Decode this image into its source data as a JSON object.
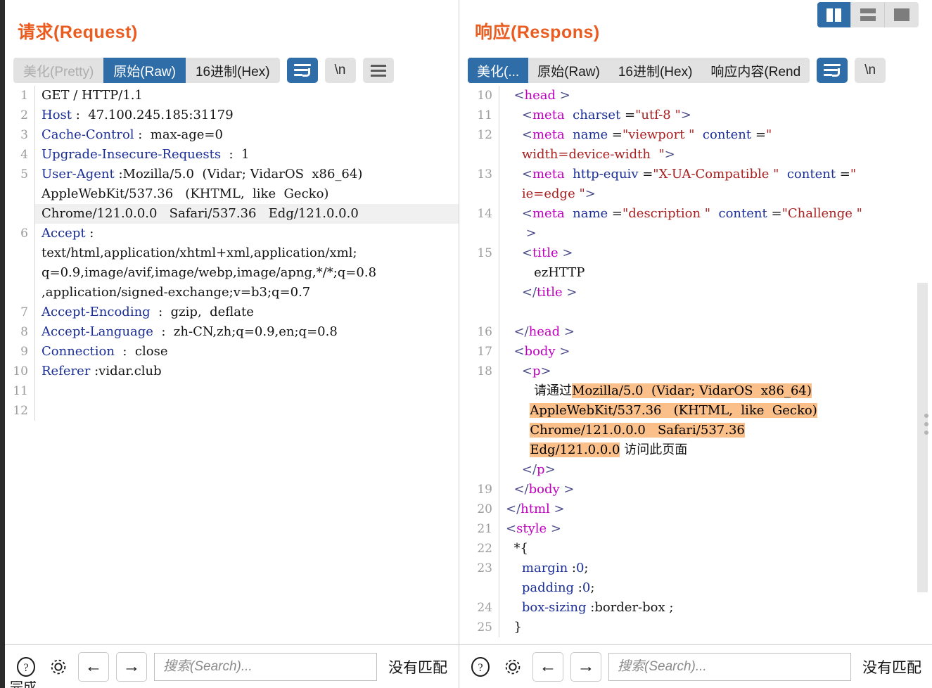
{
  "window": {
    "layout_modes": [
      {
        "name": "split-view",
        "label": "split",
        "active": true
      },
      {
        "name": "stacked-view",
        "label": "stacked",
        "active": false
      },
      {
        "name": "single-view",
        "label": "single",
        "active": false
      }
    ]
  },
  "request": {
    "title": "请求(Request)",
    "tabs": [
      {
        "label": "美化(Pretty)",
        "state": "disabled"
      },
      {
        "label": "原始(Raw)",
        "state": "active"
      },
      {
        "label": "16进制(Hex)",
        "state": "normal"
      }
    ],
    "buttons": {
      "wrap": {
        "name": "word-wrap-toggle",
        "active": true
      },
      "newline": {
        "label": "\\n",
        "name": "newline-toggle",
        "active": false
      },
      "menu": {
        "name": "more-menu",
        "active": false
      }
    },
    "lines": [
      {
        "n": "1",
        "segments": [
          {
            "t": "GET / HTTP/1.1",
            "c": "plain"
          }
        ]
      },
      {
        "n": "2",
        "segments": [
          {
            "t": "Host",
            "c": "hkey"
          },
          {
            "t": " :  47.100.245.185:31179",
            "c": "plain"
          }
        ]
      },
      {
        "n": "3",
        "segments": [
          {
            "t": "Cache-Control",
            "c": "hkey"
          },
          {
            "t": " :  max-age=0",
            "c": "plain"
          }
        ]
      },
      {
        "n": "4",
        "segments": [
          {
            "t": "Upgrade-Insecure-Requests",
            "c": "hkey"
          },
          {
            "t": "  :  1",
            "c": "plain"
          }
        ]
      },
      {
        "n": "5",
        "segments": [
          {
            "t": "User-Agent",
            "c": "hkey"
          },
          {
            "t": " :Mozilla/5.0  (Vidar; VidarOS  x86_64)",
            "c": "plain"
          }
        ]
      },
      {
        "n": "",
        "segments": [
          {
            "t": "AppleWebKit/537.36   (KHTML,  like  Gecko)",
            "c": "plain"
          }
        ]
      },
      {
        "n": "",
        "segments": [
          {
            "t": "Chrome/121.0.0.0   Safari/537.36   Edg/121.0.0.0",
            "c": "plain"
          }
        ],
        "highlight": true
      },
      {
        "n": "6",
        "segments": [
          {
            "t": "Accept",
            "c": "hkey"
          },
          {
            "t": " :",
            "c": "plain"
          }
        ]
      },
      {
        "n": "",
        "segments": [
          {
            "t": "text/html,application/xhtml+xml,application/xml;",
            "c": "plain"
          }
        ]
      },
      {
        "n": "",
        "segments": [
          {
            "t": "q=0.9,image/avif,image/webp,image/apng,*/*;q=0.8",
            "c": "plain"
          }
        ]
      },
      {
        "n": "",
        "segments": [
          {
            "t": ",application/signed-exchange;v=b3;q=0.7",
            "c": "plain"
          }
        ]
      },
      {
        "n": "7",
        "segments": [
          {
            "t": "Accept-Encoding",
            "c": "hkey"
          },
          {
            "t": "  :  gzip,  deflate",
            "c": "plain"
          }
        ]
      },
      {
        "n": "8",
        "segments": [
          {
            "t": "Accept-Language",
            "c": "hkey"
          },
          {
            "t": "  :  zh-CN,zh;q=0.9,en;q=0.8",
            "c": "plain"
          }
        ]
      },
      {
        "n": "9",
        "segments": [
          {
            "t": "Connection",
            "c": "hkey"
          },
          {
            "t": "  :  close",
            "c": "plain"
          }
        ]
      },
      {
        "n": "10",
        "segments": [
          {
            "t": "Referer",
            "c": "hkey"
          },
          {
            "t": " :vidar.club",
            "c": "plain"
          }
        ]
      },
      {
        "n": "11",
        "segments": [
          {
            "t": "",
            "c": "plain"
          }
        ]
      },
      {
        "n": "12",
        "segments": [
          {
            "t": "",
            "c": "plain"
          }
        ]
      }
    ],
    "footer": {
      "help_icon": "help-icon",
      "settings_icon": "gear-icon",
      "prev_label": "←",
      "next_label": "→",
      "search_placeholder": "搜索(Search)...",
      "search_value": "",
      "match_status": "没有匹配"
    }
  },
  "response": {
    "title": "响应(Respons)",
    "tabs": [
      {
        "label": "美化(...",
        "state": "active"
      },
      {
        "label": "原始(Raw)",
        "state": "normal"
      },
      {
        "label": "16进制(Hex)",
        "state": "normal"
      },
      {
        "label": "响应内容(Rend",
        "state": "normal"
      }
    ],
    "buttons": {
      "wrap": {
        "name": "word-wrap-toggle",
        "active": true
      },
      "newline": {
        "label": "\\n",
        "name": "newline-toggle",
        "active": false
      }
    },
    "lines": [
      {
        "n": "10",
        "segments": [
          {
            "t": "  ",
            "c": "txtblk"
          },
          {
            "t": "<",
            "c": "brk"
          },
          {
            "t": "head",
            "c": "tag"
          },
          {
            "t": " >",
            "c": "brk"
          }
        ]
      },
      {
        "n": "11",
        "segments": [
          {
            "t": "    ",
            "c": "txtblk"
          },
          {
            "t": "<",
            "c": "brk"
          },
          {
            "t": "meta",
            "c": "tag"
          },
          {
            "t": "  ",
            "c": "txtblk"
          },
          {
            "t": "charset",
            "c": "attr"
          },
          {
            "t": " =",
            "c": "txtblk"
          },
          {
            "t": "\"utf-8 \"",
            "c": "str"
          },
          {
            "t": ">",
            "c": "brk"
          }
        ]
      },
      {
        "n": "12",
        "segments": [
          {
            "t": "    ",
            "c": "txtblk"
          },
          {
            "t": "<",
            "c": "brk"
          },
          {
            "t": "meta",
            "c": "tag"
          },
          {
            "t": "  ",
            "c": "txtblk"
          },
          {
            "t": "name",
            "c": "attr"
          },
          {
            "t": " =",
            "c": "txtblk"
          },
          {
            "t": "\"viewport \"",
            "c": "str"
          },
          {
            "t": "  ",
            "c": "txtblk"
          },
          {
            "t": "content",
            "c": "attr"
          },
          {
            "t": " =",
            "c": "txtblk"
          },
          {
            "t": "\"",
            "c": "str"
          }
        ]
      },
      {
        "n": "",
        "segments": [
          {
            "t": "    ",
            "c": "txtblk"
          },
          {
            "t": "width=device-width  \"",
            "c": "str"
          },
          {
            "t": ">",
            "c": "brk"
          }
        ]
      },
      {
        "n": "13",
        "segments": [
          {
            "t": "    ",
            "c": "txtblk"
          },
          {
            "t": "<",
            "c": "brk"
          },
          {
            "t": "meta",
            "c": "tag"
          },
          {
            "t": "  ",
            "c": "txtblk"
          },
          {
            "t": "http-equiv",
            "c": "attr"
          },
          {
            "t": " =",
            "c": "txtblk"
          },
          {
            "t": "\"X-UA-Compatible \"",
            "c": "str"
          },
          {
            "t": "  ",
            "c": "txtblk"
          },
          {
            "t": "content",
            "c": "attr"
          },
          {
            "t": " =",
            "c": "txtblk"
          },
          {
            "t": "\"",
            "c": "str"
          }
        ]
      },
      {
        "n": "",
        "segments": [
          {
            "t": "    ",
            "c": "txtblk"
          },
          {
            "t": "ie=edge \"",
            "c": "str"
          },
          {
            "t": ">",
            "c": "brk"
          }
        ]
      },
      {
        "n": "14",
        "segments": [
          {
            "t": "    ",
            "c": "txtblk"
          },
          {
            "t": "<",
            "c": "brk"
          },
          {
            "t": "meta",
            "c": "tag"
          },
          {
            "t": "  ",
            "c": "txtblk"
          },
          {
            "t": "name",
            "c": "attr"
          },
          {
            "t": " =",
            "c": "txtblk"
          },
          {
            "t": "\"description \"",
            "c": "str"
          },
          {
            "t": "  ",
            "c": "txtblk"
          },
          {
            "t": "content",
            "c": "attr"
          },
          {
            "t": " =",
            "c": "txtblk"
          },
          {
            "t": "\"Challenge \"",
            "c": "str"
          }
        ]
      },
      {
        "n": "",
        "segments": [
          {
            "t": "     ",
            "c": "txtblk"
          },
          {
            "t": ">",
            "c": "brk"
          }
        ]
      },
      {
        "n": "15",
        "segments": [
          {
            "t": "    ",
            "c": "txtblk"
          },
          {
            "t": "<",
            "c": "brk"
          },
          {
            "t": "title",
            "c": "tag"
          },
          {
            "t": " >",
            "c": "brk"
          }
        ]
      },
      {
        "n": "",
        "segments": [
          {
            "t": "       ezHTTP",
            "c": "txtblk"
          }
        ]
      },
      {
        "n": "",
        "segments": [
          {
            "t": "    ",
            "c": "txtblk"
          },
          {
            "t": "</",
            "c": "brk"
          },
          {
            "t": "title",
            "c": "tag"
          },
          {
            "t": " >",
            "c": "brk"
          }
        ]
      },
      {
        "n": "",
        "segments": [
          {
            "t": "",
            "c": "txtblk"
          }
        ]
      },
      {
        "n": "16",
        "segments": [
          {
            "t": "  ",
            "c": "txtblk"
          },
          {
            "t": "</",
            "c": "brk"
          },
          {
            "t": "head",
            "c": "tag"
          },
          {
            "t": " >",
            "c": "brk"
          }
        ]
      },
      {
        "n": "17",
        "segments": [
          {
            "t": "  ",
            "c": "txtblk"
          },
          {
            "t": "<",
            "c": "brk"
          },
          {
            "t": "body",
            "c": "tag"
          },
          {
            "t": " >",
            "c": "brk"
          }
        ]
      },
      {
        "n": "18",
        "segments": [
          {
            "t": "    ",
            "c": "txtblk"
          },
          {
            "t": "<",
            "c": "brk"
          },
          {
            "t": "p",
            "c": "tag"
          },
          {
            "t": ">",
            "c": "brk"
          }
        ]
      },
      {
        "n": "",
        "segments": [
          {
            "t": "       请通过",
            "c": "txtblk"
          },
          {
            "t": "Mozilla/5.0  (Vidar; VidarOS  x86_64)",
            "c": "mark"
          }
        ]
      },
      {
        "n": "",
        "segments": [
          {
            "t": "      ",
            "c": "txtblk"
          },
          {
            "t": "AppleWebKit/537.36   (KHTML,  like  Gecko)",
            "c": "mark"
          }
        ]
      },
      {
        "n": "",
        "segments": [
          {
            "t": "      ",
            "c": "txtblk"
          },
          {
            "t": "Chrome/121.0.0.0   Safari/537.36",
            "c": "mark"
          }
        ]
      },
      {
        "n": "",
        "segments": [
          {
            "t": "      ",
            "c": "txtblk"
          },
          {
            "t": "Edg/121.0.0.0",
            "c": "mark"
          },
          {
            "t": " 访问此页面",
            "c": "txtblk"
          }
        ]
      },
      {
        "n": "",
        "segments": [
          {
            "t": "    ",
            "c": "txtblk"
          },
          {
            "t": "</",
            "c": "brk"
          },
          {
            "t": "p",
            "c": "tag"
          },
          {
            "t": ">",
            "c": "brk"
          }
        ]
      },
      {
        "n": "19",
        "segments": [
          {
            "t": "  ",
            "c": "txtblk"
          },
          {
            "t": "</",
            "c": "brk"
          },
          {
            "t": "body",
            "c": "tag"
          },
          {
            "t": " >",
            "c": "brk"
          }
        ]
      },
      {
        "n": "20",
        "segments": [
          {
            "t": "</",
            "c": "brk"
          },
          {
            "t": "html",
            "c": "tag"
          },
          {
            "t": " >",
            "c": "brk"
          }
        ]
      },
      {
        "n": "21",
        "segments": [
          {
            "t": "<",
            "c": "brk"
          },
          {
            "t": "style",
            "c": "tag"
          },
          {
            "t": " >",
            "c": "brk"
          }
        ]
      },
      {
        "n": "22",
        "segments": [
          {
            "t": "  *{",
            "c": "txtblk"
          }
        ]
      },
      {
        "n": "23",
        "segments": [
          {
            "t": "    ",
            "c": "txtblk"
          },
          {
            "t": "margin",
            "c": "prop"
          },
          {
            "t": " :",
            "c": "txtblk"
          },
          {
            "t": "0",
            "c": "num"
          },
          {
            "t": ";",
            "c": "txtblk"
          }
        ]
      },
      {
        "n": "",
        "segments": [
          {
            "t": "    ",
            "c": "txtblk"
          },
          {
            "t": "padding",
            "c": "prop"
          },
          {
            "t": " :",
            "c": "txtblk"
          },
          {
            "t": "0",
            "c": "num"
          },
          {
            "t": ";",
            "c": "txtblk"
          }
        ]
      },
      {
        "n": "24",
        "segments": [
          {
            "t": "    ",
            "c": "txtblk"
          },
          {
            "t": "box-sizing",
            "c": "prop"
          },
          {
            "t": " :border-box ;",
            "c": "txtblk"
          }
        ]
      },
      {
        "n": "25",
        "segments": [
          {
            "t": "  }",
            "c": "txtblk"
          }
        ]
      }
    ],
    "footer": {
      "help_icon": "help-icon",
      "settings_icon": "gear-icon",
      "prev_label": "←",
      "next_label": "→",
      "search_placeholder": "搜索(Search)...",
      "search_value": "",
      "match_status": "没有匹配"
    }
  },
  "status_bar": {
    "text": "完成"
  },
  "colors": {
    "accent_orange": "#ea5b1f",
    "accent_blue": "#2f6da8",
    "tab_bg": "#e2e2e2",
    "highlight_orange": "#fbc08a",
    "tag_magenta": "#c000c0",
    "attr_blue": "#1b2f96",
    "string_red": "#a82020"
  }
}
